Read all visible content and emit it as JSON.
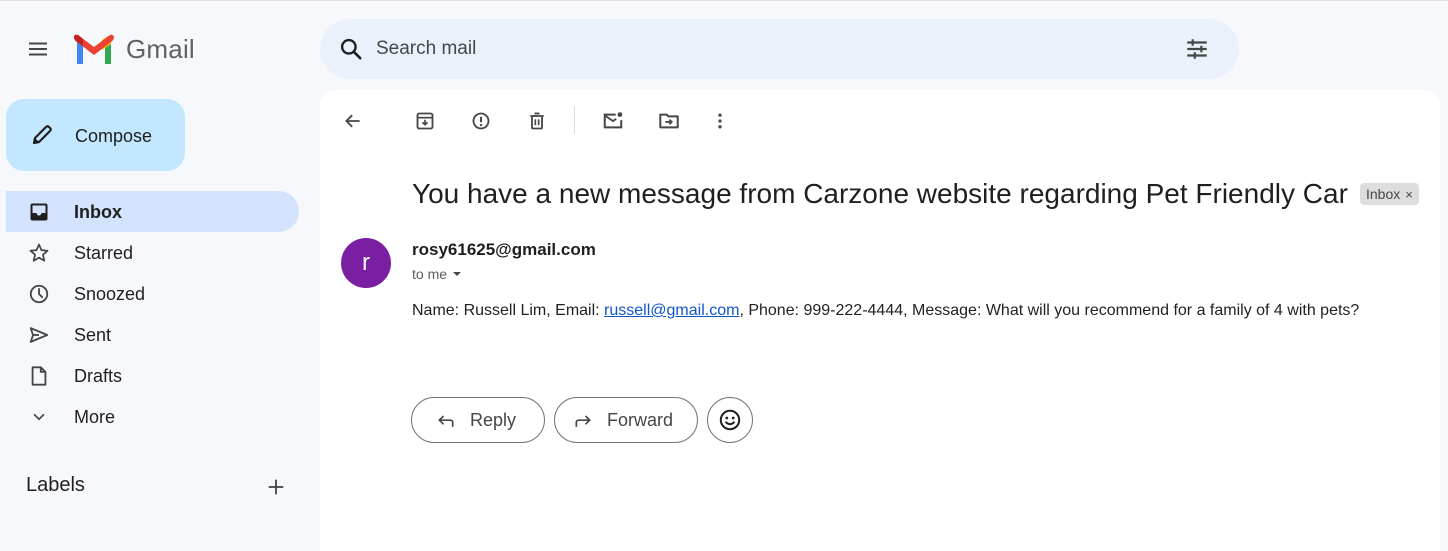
{
  "header": {
    "app_name": "Gmail",
    "search_placeholder": "Search mail",
    "icons": [
      "menu-icon",
      "gmail-logo",
      "search-icon",
      "tune-icon"
    ]
  },
  "sidebar": {
    "compose_label": "Compose",
    "items": [
      {
        "label": "Inbox",
        "icon": "inbox-icon",
        "active": true
      },
      {
        "label": "Starred",
        "icon": "star-icon",
        "active": false
      },
      {
        "label": "Snoozed",
        "icon": "clock-icon",
        "active": false
      },
      {
        "label": "Sent",
        "icon": "send-icon",
        "active": false
      },
      {
        "label": "Drafts",
        "icon": "draft-icon",
        "active": false
      },
      {
        "label": "More",
        "icon": "chevron-down-icon",
        "active": false
      }
    ],
    "labels_heading": "Labels"
  },
  "toolbar": {
    "icons": [
      "back-arrow-icon",
      "archive-icon",
      "report-spam-icon",
      "delete-icon",
      "mark-unread-icon",
      "move-to-icon",
      "more-vert-icon"
    ]
  },
  "email": {
    "subject": "You have a new message from Carzone website regarding Pet Friendly Car",
    "label_chip": "Inbox",
    "label_chip_close": "×",
    "avatar_letter": "r",
    "sender": "rosy61625@gmail.com",
    "recipient": "to me",
    "body_before_link": "Name: Russell Lim, Email: ",
    "body_link": "russell@gmail.com",
    "body_after_link": ", Phone: 999-222-4444, Message: What will you recommend for a family of 4 with pets?"
  },
  "actions": {
    "reply_label": "Reply",
    "forward_label": "Forward"
  },
  "colors": {
    "background": "#f6f8fc",
    "compose": "#c2e7ff",
    "active_nav": "#d3e3fd",
    "search": "#eaf1fb",
    "avatar": "#7b1fa2",
    "link": "#1155cc"
  }
}
